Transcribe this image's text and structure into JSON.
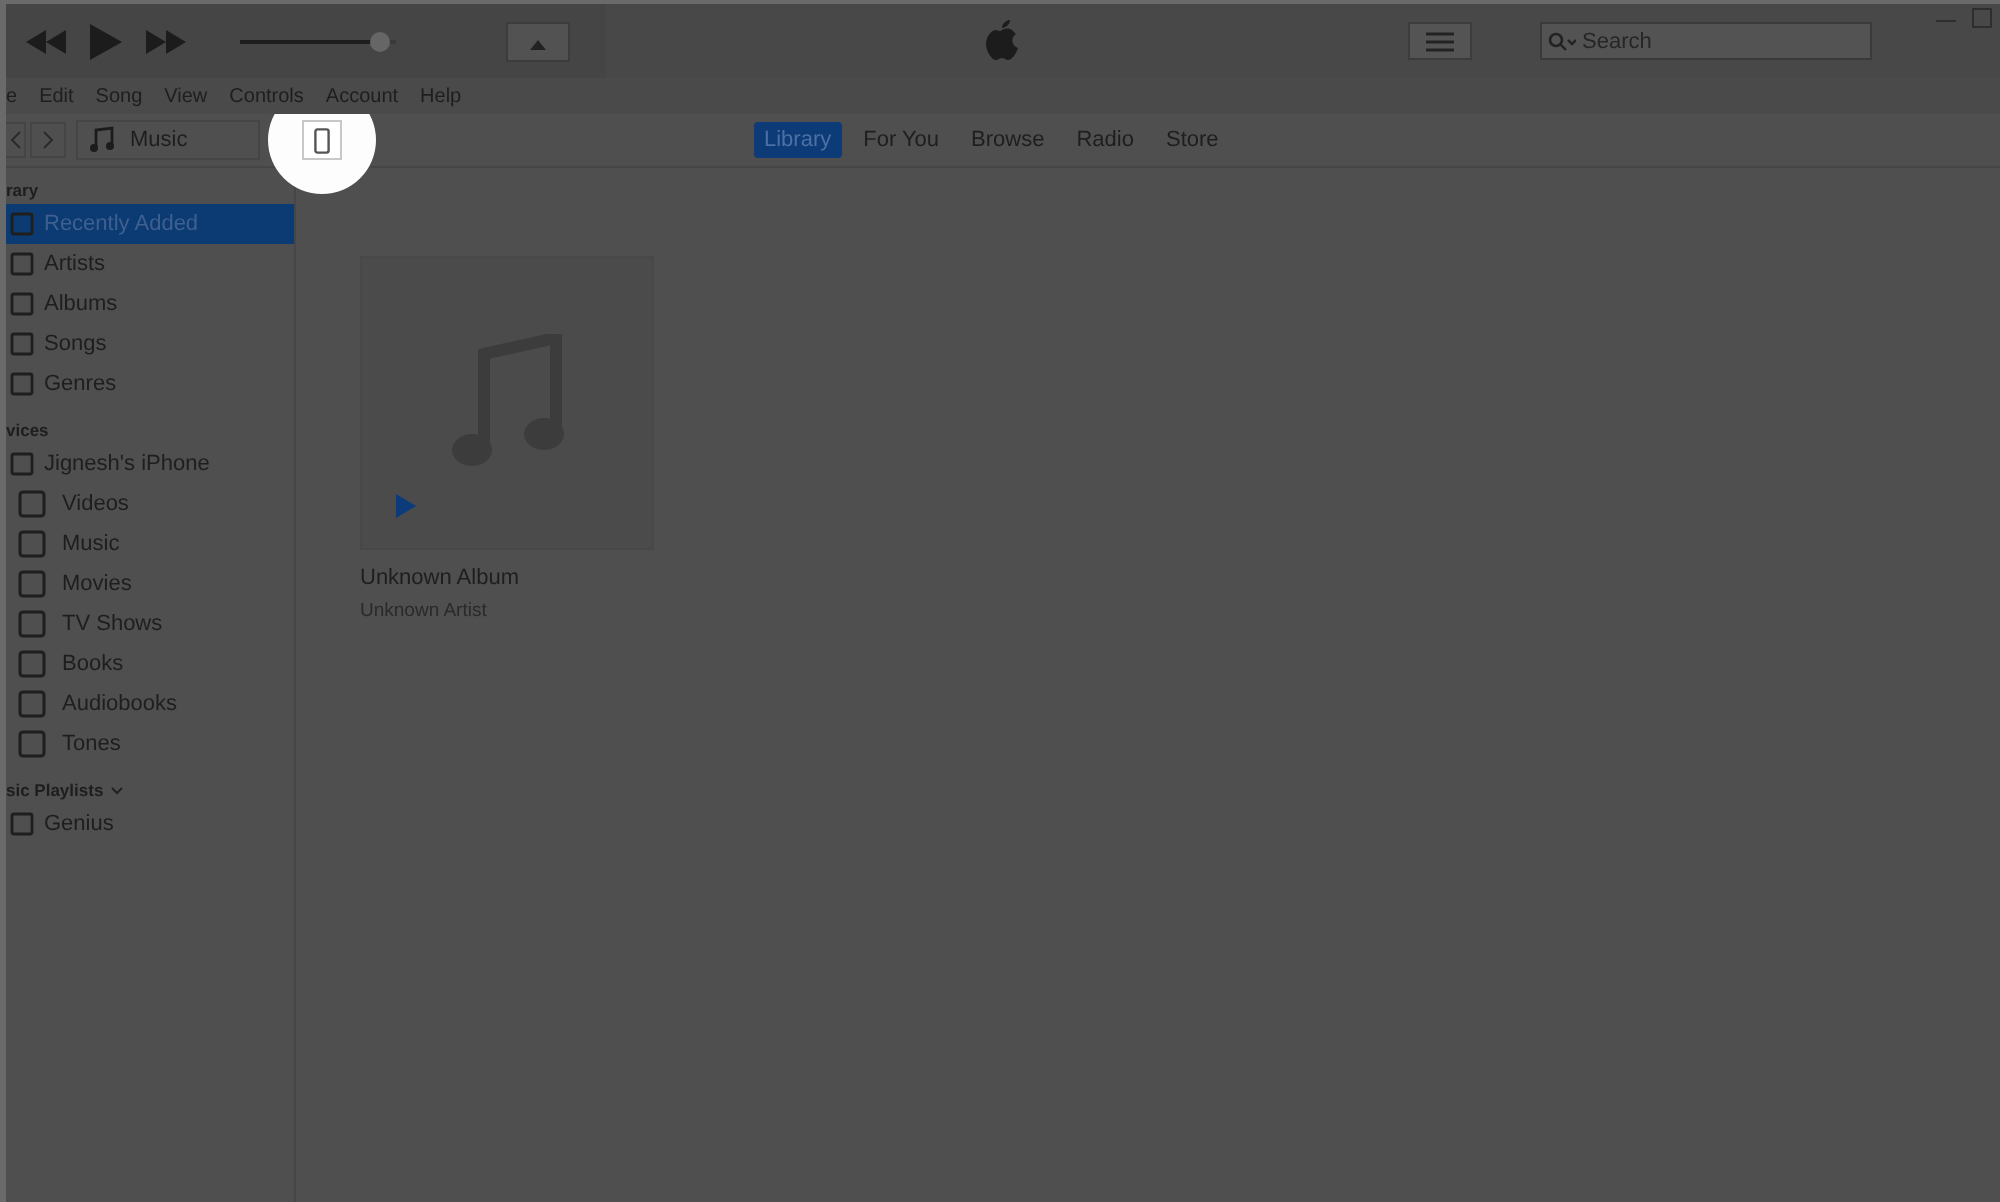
{
  "toolbar": {
    "volume": {
      "level": 0.9
    },
    "search": {
      "placeholder": "Search"
    }
  },
  "menu": [
    "e",
    "Edit",
    "Song",
    "View",
    "Controls",
    "Account",
    "Help"
  ],
  "nav": {
    "source": "Music"
  },
  "tabs": [
    {
      "label": "Library",
      "selected": true
    },
    {
      "label": "For You",
      "selected": false
    },
    {
      "label": "Browse",
      "selected": false
    },
    {
      "label": "Radio",
      "selected": false
    },
    {
      "label": "Store",
      "selected": false
    }
  ],
  "sidebar": [
    {
      "heading": "rary",
      "items": [
        {
          "label": "Recently Added",
          "selected": true
        },
        {
          "label": "Artists",
          "selected": false
        },
        {
          "label": "Albums",
          "selected": false
        },
        {
          "label": "Songs",
          "selected": false
        },
        {
          "label": "Genres",
          "selected": false
        }
      ]
    },
    {
      "heading": "vices",
      "items": [
        {
          "label": "Jignesh's iPhone",
          "selected": false,
          "children": [
            {
              "label": "Videos",
              "selected": false
            },
            {
              "label": "Music",
              "selected": false
            },
            {
              "label": "Movies",
              "selected": false
            },
            {
              "label": "TV Shows",
              "selected": false
            },
            {
              "label": "Books",
              "selected": false
            },
            {
              "label": "Audiobooks",
              "selected": false
            },
            {
              "label": "Tones",
              "selected": false
            }
          ]
        }
      ]
    },
    {
      "heading": "sic Playlists",
      "items": [
        {
          "label": "Genius",
          "selected": false
        }
      ]
    }
  ],
  "album": {
    "title": "Unknown Album",
    "artist": "Unknown Artist"
  }
}
